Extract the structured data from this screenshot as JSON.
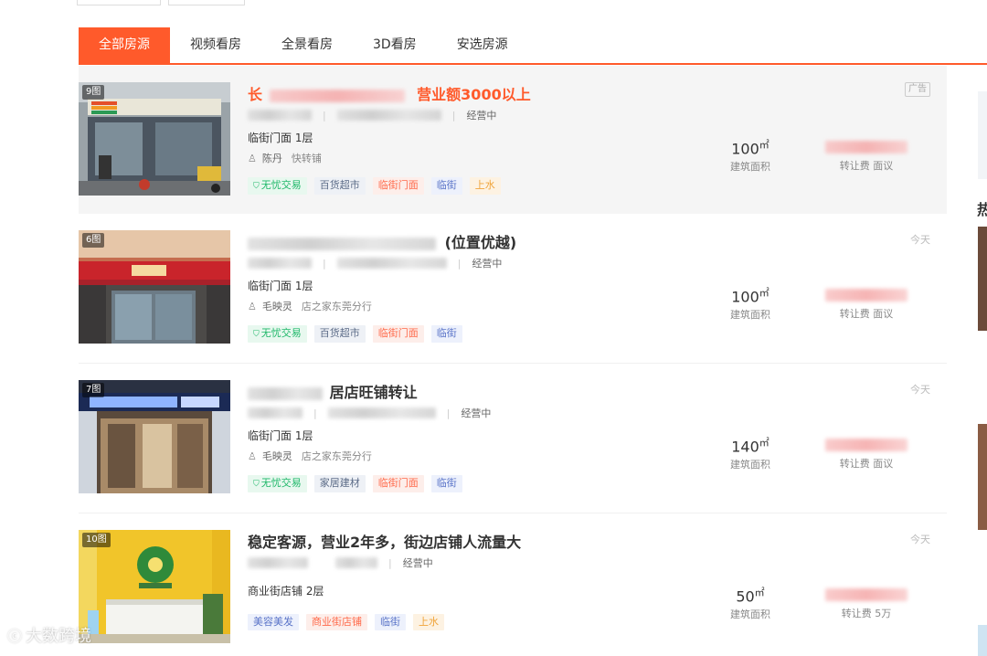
{
  "tabs": [
    "全部房源",
    "视频看房",
    "全景看房",
    "3D看房",
    "安选房源"
  ],
  "ad_label": "广告",
  "labels": {
    "area": "建筑面积",
    "status": "经营中"
  },
  "listings": [
    {
      "photo_count": "9图",
      "title_prefix": "长",
      "title_suffix": "营业额3000以上",
      "floor": "临街门面 1层",
      "agent": "陈丹",
      "company": "快转铺",
      "tags": [
        "无忧交易",
        "百货超市",
        "临街门面",
        "临街",
        "上水"
      ],
      "area_value": "100",
      "area_unit": "㎡",
      "fee": "转让费 面议",
      "date": ""
    },
    {
      "photo_count": "6图",
      "title_suffix": "(位置优越)",
      "floor": "临街门面 1层",
      "agent": "毛映灵",
      "company": "店之家东莞分行",
      "tags": [
        "无忧交易",
        "百货超市",
        "临街门面",
        "临街"
      ],
      "area_value": "100",
      "area_unit": "㎡",
      "fee": "转让费 面议",
      "date": "今天"
    },
    {
      "photo_count": "7图",
      "title_suffix": "居店旺铺转让",
      "floor": "临街门面 1层",
      "agent": "毛映灵",
      "company": "店之家东莞分行",
      "tags": [
        "无忧交易",
        "家居建材",
        "临街门面",
        "临街"
      ],
      "area_value": "140",
      "area_unit": "㎡",
      "fee": "转让费 面议",
      "date": "今天"
    },
    {
      "photo_count": "10图",
      "title_suffix": "稳定客源，营业2年多，街边店铺人流量大",
      "floor": "商业街店铺 2层",
      "tags": [
        "美容美发",
        "商业街店铺",
        "临街",
        "上水"
      ],
      "area_value": "50",
      "area_unit": "㎡",
      "fee": "转让费 5万",
      "date": "今天"
    }
  ],
  "side": {
    "hot_heading": "热"
  },
  "watermark": "大数跨境",
  "colors": {
    "accent": "#ff5a2b"
  }
}
